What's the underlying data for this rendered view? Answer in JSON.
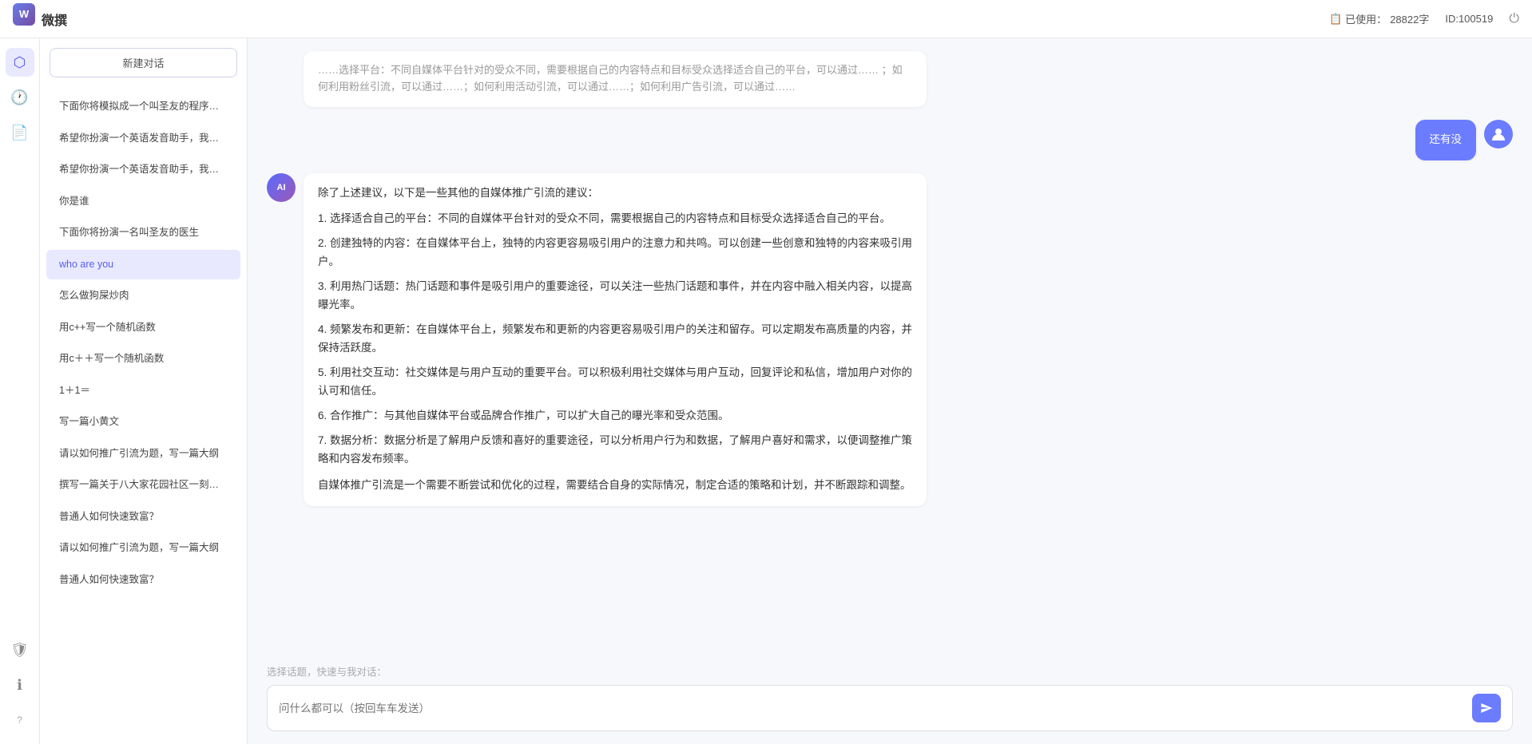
{
  "topbar": {
    "title": "微撰",
    "usage_label": "已使用：",
    "usage_count": "28822字",
    "id_label": "ID:100519",
    "power_icon": "⏻"
  },
  "icon_sidebar": {
    "logo_letter": "W",
    "icons": [
      {
        "name": "box-icon",
        "symbol": "⬡",
        "active": true
      },
      {
        "name": "clock-icon",
        "symbol": "⏰",
        "active": false
      },
      {
        "name": "doc-icon",
        "symbol": "📄",
        "active": false
      }
    ],
    "bottom_icons": [
      {
        "name": "shield-icon",
        "symbol": "🛡"
      },
      {
        "name": "info-icon",
        "symbol": "ℹ"
      },
      {
        "name": "unknown-icon",
        "symbol": "?"
      }
    ]
  },
  "history_sidebar": {
    "new_chat_label": "新建对话",
    "items": [
      {
        "id": 1,
        "text": "下面你将模拟成一个叫圣友的程序员，我说...",
        "active": false
      },
      {
        "id": 2,
        "text": "希望你扮演一个英语发音助手，我提供给你...",
        "active": false
      },
      {
        "id": 3,
        "text": "希望你扮演一个英语发音助手，我提供给你...",
        "active": false
      },
      {
        "id": 4,
        "text": "你是谁",
        "active": false
      },
      {
        "id": 5,
        "text": "下面你将扮演一名叫圣友的医生",
        "active": false
      },
      {
        "id": 6,
        "text": "who are you",
        "active": true
      },
      {
        "id": 7,
        "text": "怎么做狗屎炒肉",
        "active": false
      },
      {
        "id": 8,
        "text": "用c++写一个随机函数",
        "active": false
      },
      {
        "id": 9,
        "text": "用c＋＋写一个随机函数",
        "active": false
      },
      {
        "id": 10,
        "text": "1＋1＝",
        "active": false
      },
      {
        "id": 11,
        "text": "写一篇小黄文",
        "active": false
      },
      {
        "id": 12,
        "text": "请以如何推广引流为题，写一篇大纲",
        "active": false
      },
      {
        "id": 13,
        "text": "撰写一篇关于八大家花园社区一刻钟便民生...",
        "active": false
      },
      {
        "id": 14,
        "text": "普通人如何快速致富？",
        "active": false
      },
      {
        "id": 15,
        "text": "请以如何推广引流为题，写一篇大纲",
        "active": false
      },
      {
        "id": 16,
        "text": "普通人如何快速致富？",
        "active": false
      }
    ]
  },
  "chat": {
    "partial_text": "……选择平台：不同自媒体平台针对的受众不同，需要根据自己的内容特点和目标受众选择适合自己的平台，可以通过…… ；如何利用粉丝引流，可以通过……；如何利用活动引流，可以通过……；如何利用广告引流，可以通过……",
    "user_message": "还有没",
    "user_avatar_symbol": "👤",
    "ai_avatar_symbol": "AI",
    "ai_response_intro": "除了上述建议，以下是一些其他的自媒体推广引流的建议：",
    "ai_response_items": [
      "1. 选择适合自己的平台：不同的自媒体平台针对的受众不同，需要根据自己的内容特点和目标受众选择适合自己的平台。",
      "2. 创建独特的内容：在自媒体平台上，独特的内容更容易吸引用户的注意力和共鸣。可以创建一些创意和独特的内容来吸引用户。",
      "3. 利用热门话题：热门话题和事件是吸引用户的重要途径，可以关注一些热门话题和事件，并在内容中融入相关内容，以提高曝光率。",
      "4. 频繁发布和更新：在自媒体平台上，频繁发布和更新的内容更容易吸引用户的关注和留存。可以定期发布高质量的内容，并保持活跃度。",
      "5. 利用社交互动：社交媒体是与用户互动的重要平台。可以积极利用社交媒体与用户互动，回复评论和私信，增加用户对你的认可和信任。",
      "6. 合作推广：与其他自媒体平台或品牌合作推广，可以扩大自己的曝光率和受众范围。",
      "7. 数据分析：数据分析是了解用户反馈和喜好的重要途径，可以分析用户行为和数据，了解用户喜好和需求，以便调整推广策略和内容发布频率。"
    ],
    "ai_response_conclusion": "自媒体推广引流是一个需要不断尝试和优化的过程，需要结合自身的实际情况，制定合适的策略和计划，并不断跟踪和调整。",
    "input_placeholder": "问什么都可以（按回车车发送）",
    "quick_topics_label": "选择话题，快速与我对话：",
    "send_icon": "➤"
  }
}
